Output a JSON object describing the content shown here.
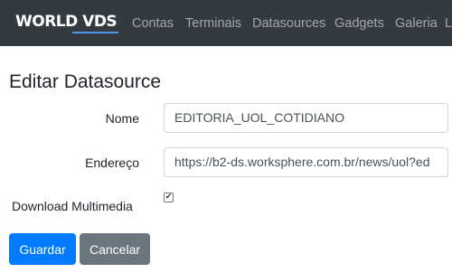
{
  "navbar": {
    "brand": "WORLD VDS",
    "links": [
      "Contas",
      "Terminais",
      "Datasources",
      "Gadgets",
      "Galeria",
      "L"
    ]
  },
  "page": {
    "title": "Editar Datasource"
  },
  "form": {
    "nome_label": "Nome",
    "nome_value": "EDITORIA_UOL_COTIDIANO",
    "endereco_label": "Endereço",
    "endereco_value": "https://b2-ds.worksphere.com.br/news/uol?ed",
    "download_label": "Download Multimedia",
    "download_checked": true
  },
  "buttons": {
    "save": "Guardar",
    "cancel": "Cancelar"
  },
  "colors": {
    "navbar_bg": "#343a40",
    "primary": "#007bff",
    "secondary": "#6c757d"
  }
}
